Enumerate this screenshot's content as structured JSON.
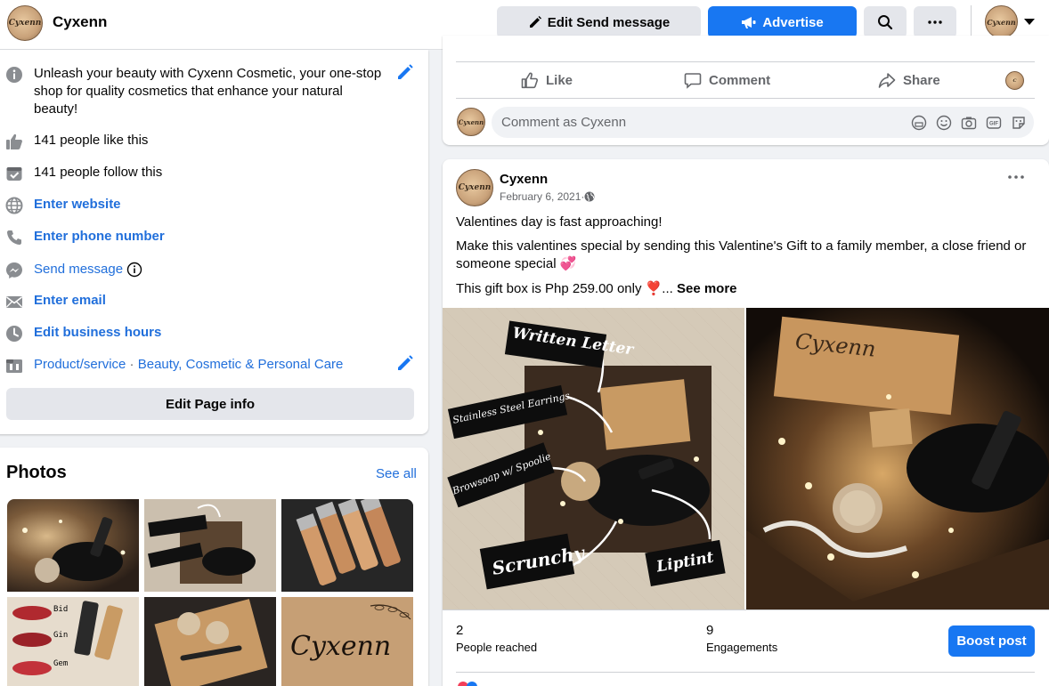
{
  "topbar": {
    "page_name": "Cyxenn",
    "logo_text": "Cyxenn",
    "edit_send_message": "Edit Send message",
    "advertise": "Advertise"
  },
  "intro": {
    "description": "Unleash your beauty with Cyxenn Cosmetic, your one-stop shop for quality cosmetics that enhance your natural beauty!",
    "likes": "141 people like this",
    "follows": "141 people follow this",
    "website": "Enter website",
    "phone": "Enter phone number",
    "send_message": "Send message",
    "email": "Enter email",
    "hours": "Edit business hours",
    "category_prefix": "Product/service",
    "category_sep": " · ",
    "category": "Beauty, Cosmetic & Personal Care",
    "edit_page_info": "Edit Page info"
  },
  "photos": {
    "title": "Photos",
    "see_all": "See all",
    "thumb_labels": [
      "Stainless Steel Earrings",
      "Browsoap w/ Spoolie",
      "Bid",
      "Gin",
      "Gem",
      "Cyxenn"
    ]
  },
  "prev_post_actions": {
    "like": "Like",
    "comment": "Comment",
    "share": "Share",
    "comment_placeholder": "Comment as Cyxenn"
  },
  "post": {
    "author": "Cyxenn",
    "date": "February 6, 2021",
    "date_sep": " · ",
    "line1": "Valentines day is fast approaching!",
    "line2": "Make this valentines special by sending this Valentine's Gift to a family member, a close friend or someone special 💞",
    "line3": "This gift box is Php 259.00 only ❣️...",
    "see_more": "See more",
    "image_labels": [
      "Written Letter",
      "Stainless Steel Earrings",
      "Browsoap w/ Spoolie",
      "Scrunchy",
      "Liptint",
      "Cyxenn"
    ],
    "reached_count": "2",
    "reached_label": "People reached",
    "engagements_count": "9",
    "engagements_label": "Engagements",
    "boost": "Boost post"
  },
  "colors": {
    "brand_blue": "#1877f2",
    "link_blue": "#216fdb",
    "gray_button": "#e4e6eb",
    "background": "#f0f2f5"
  }
}
